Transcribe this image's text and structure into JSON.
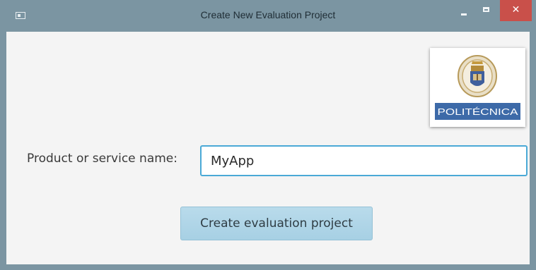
{
  "window": {
    "title": "Create New Evaluation Project",
    "controls": {
      "minimize_icon": "minimize-icon",
      "maximize_icon": "maximize-icon",
      "close_glyph": "✕"
    },
    "colors": {
      "chrome": "#7b95a2",
      "close_button": "#c9504a",
      "content_background": "#f4f4f4"
    }
  },
  "logo": {
    "icon": "upm-seal-icon",
    "wordmark": "POLITÉCNICA",
    "wordmark_color": "#3d6aa8"
  },
  "form": {
    "name_label": "Product or service name:",
    "name_value": "MyApp",
    "focus_color": "#4aa9d6"
  },
  "actions": {
    "create_label": "Create evaluation project",
    "button_color": "#b2d6e8"
  }
}
